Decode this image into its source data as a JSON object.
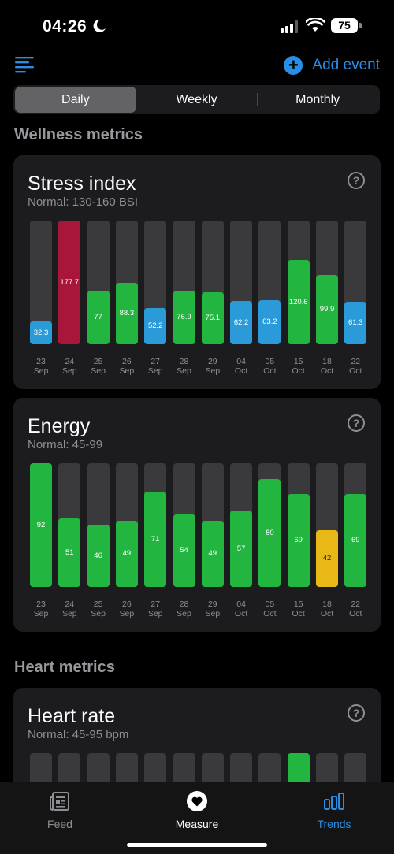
{
  "status": {
    "time": "04:26",
    "battery": "75"
  },
  "header": {
    "add_event_label": "Add event"
  },
  "segments": [
    "Daily",
    "Weekly",
    "Monthly"
  ],
  "active_segment": "Daily",
  "sections": {
    "wellness": "Wellness metrics",
    "heart": "Heart metrics"
  },
  "colors": {
    "accent": "#2a8ee6",
    "high": "#a8173a",
    "normal": "#22b53f",
    "low": "#2a9bd8",
    "warn": "#e8b817",
    "track": "#3a3a3c"
  },
  "stress": {
    "title": "Stress index",
    "normal": "Normal: 130-160 BSI",
    "help": "?",
    "chart_data": {
      "type": "bar",
      "categories": [
        "23 Sep",
        "24 Sep",
        "25 Sep",
        "26 Sep",
        "27 Sep",
        "28 Sep",
        "29 Sep",
        "04 Oct",
        "05 Oct",
        "15 Oct",
        "18 Oct",
        "22 Oct"
      ],
      "values": [
        32.3,
        177.7,
        77,
        88.3,
        52.2,
        76.9,
        75.1,
        62.2,
        63.2,
        120.6,
        99.9,
        61.3
      ],
      "labels": [
        "32.3",
        "177.7",
        "77",
        "88.3",
        "52.2",
        "76.9",
        "75.1",
        "62.2",
        "63.2",
        "120.6",
        "99.9",
        "61.3"
      ],
      "status": [
        "low",
        "high",
        "normal",
        "normal",
        "low",
        "normal",
        "normal",
        "low",
        "low",
        "normal",
        "normal",
        "low"
      ],
      "ylim": [
        0,
        177.7
      ]
    }
  },
  "energy": {
    "title": "Energy",
    "normal": "Normal: 45-99",
    "help": "?",
    "chart_data": {
      "type": "bar",
      "categories": [
        "23 Sep",
        "24 Sep",
        "25 Sep",
        "26 Sep",
        "27 Sep",
        "28 Sep",
        "29 Sep",
        "04 Oct",
        "05 Oct",
        "15 Oct",
        "18 Oct",
        "22 Oct"
      ],
      "values": [
        92,
        51,
        46,
        49,
        71,
        54,
        49,
        57,
        80,
        69,
        42,
        69
      ],
      "labels": [
        "92",
        "51",
        "46",
        "49",
        "71",
        "54",
        "49",
        "57",
        "80",
        "69",
        "42",
        "69"
      ],
      "status": [
        "normal",
        "normal",
        "normal",
        "normal",
        "normal",
        "normal",
        "normal",
        "normal",
        "normal",
        "normal",
        "warn",
        "normal"
      ],
      "ylim": [
        0,
        92
      ]
    }
  },
  "heart_rate": {
    "title": "Heart rate",
    "normal": "Normal: 45-95 bpm",
    "help": "?",
    "highlight_index": 9
  },
  "tabbar": {
    "feed": "Feed",
    "measure": "Measure",
    "trends": "Trends"
  }
}
